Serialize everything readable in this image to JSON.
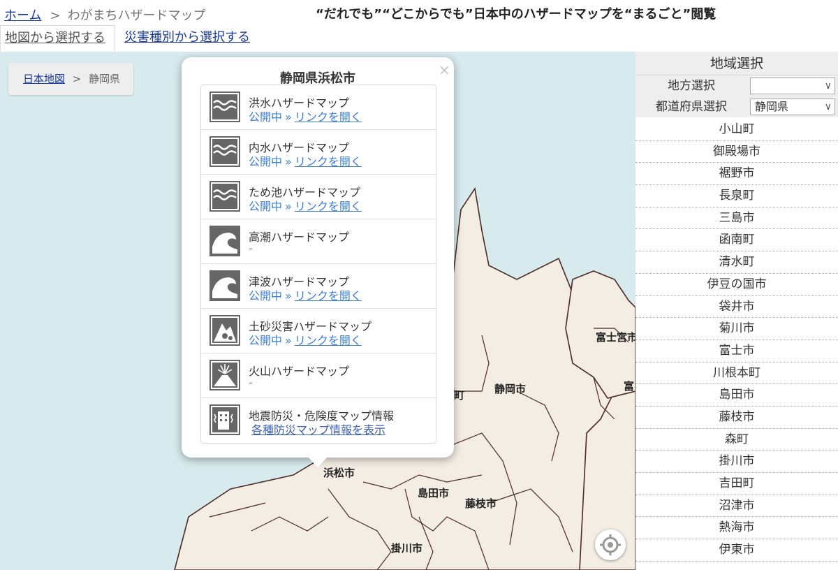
{
  "breadcrumb_top": {
    "home": "ホーム",
    "separator": ">",
    "current": "わがまちハザードマップ"
  },
  "headline": "“だれでも”“どこからでも”日本中のハザードマップを“まるごと”閲覧",
  "tabs": [
    {
      "label": "地図から選択する",
      "active": true
    },
    {
      "label": "災害種別から選択する",
      "active": false
    }
  ],
  "map": {
    "breadcrumb": {
      "root": "日本地図",
      "separator": ">",
      "current": "静岡県"
    },
    "labels": [
      "富士宮市",
      "静岡市",
      "町",
      "富",
      "浜松市",
      "島田市",
      "藤枝市",
      "掛川市"
    ]
  },
  "popup": {
    "title": "静岡県浜松市",
    "close": "×",
    "status_open": "公開中",
    "link_arrow": "»",
    "link_text": "リンクを開く",
    "items": [
      {
        "name": "洪水ハザードマップ",
        "icon": "flood-icon",
        "available": true,
        "status": "公開中",
        "link": "リンクを開く"
      },
      {
        "name": "内水ハザードマップ",
        "icon": "inland-flood-icon",
        "available": true,
        "status": "公開中",
        "link": "リンクを開く"
      },
      {
        "name": "ため池ハザードマップ",
        "icon": "reservoir-icon",
        "available": true,
        "status": "公開中",
        "link": "リンクを開く"
      },
      {
        "name": "高潮ハザードマップ",
        "icon": "storm-surge-icon",
        "available": false,
        "status": "-"
      },
      {
        "name": "津波ハザードマップ",
        "icon": "tsunami-icon",
        "available": true,
        "status": "公開中",
        "link": "リンクを開く"
      },
      {
        "name": "土砂災害ハザードマップ",
        "icon": "landslide-icon",
        "available": true,
        "status": "公開中",
        "link": "リンクを開く"
      },
      {
        "name": "火山ハザードマップ",
        "icon": "volcano-icon",
        "available": false,
        "status": "-"
      },
      {
        "name": "地震防災・危険度マップ情報",
        "icon": "earthquake-building-icon",
        "link_only": "各種防災マップ情報を表示"
      }
    ]
  },
  "panel": {
    "title": "地域選択",
    "region_label": "地方選択",
    "region_value": "",
    "prefecture_label": "都道府県選択",
    "prefecture_value": "静岡県",
    "cities": [
      "小山町",
      "御殿場市",
      "裾野市",
      "長泉町",
      "三島市",
      "函南町",
      "清水町",
      "伊豆の国市",
      "袋井市",
      "菊川市",
      "富士市",
      "川根本町",
      "島田市",
      "藤枝市",
      "森町",
      "掛川市",
      "吉田町",
      "沼津市",
      "熱海市",
      "伊東市"
    ]
  },
  "colors": {
    "sea": "#d7eaed",
    "land": "#f3ede3",
    "border": "#4a2a22",
    "link": "#1a3a9a",
    "status": "#3b7ed6"
  }
}
